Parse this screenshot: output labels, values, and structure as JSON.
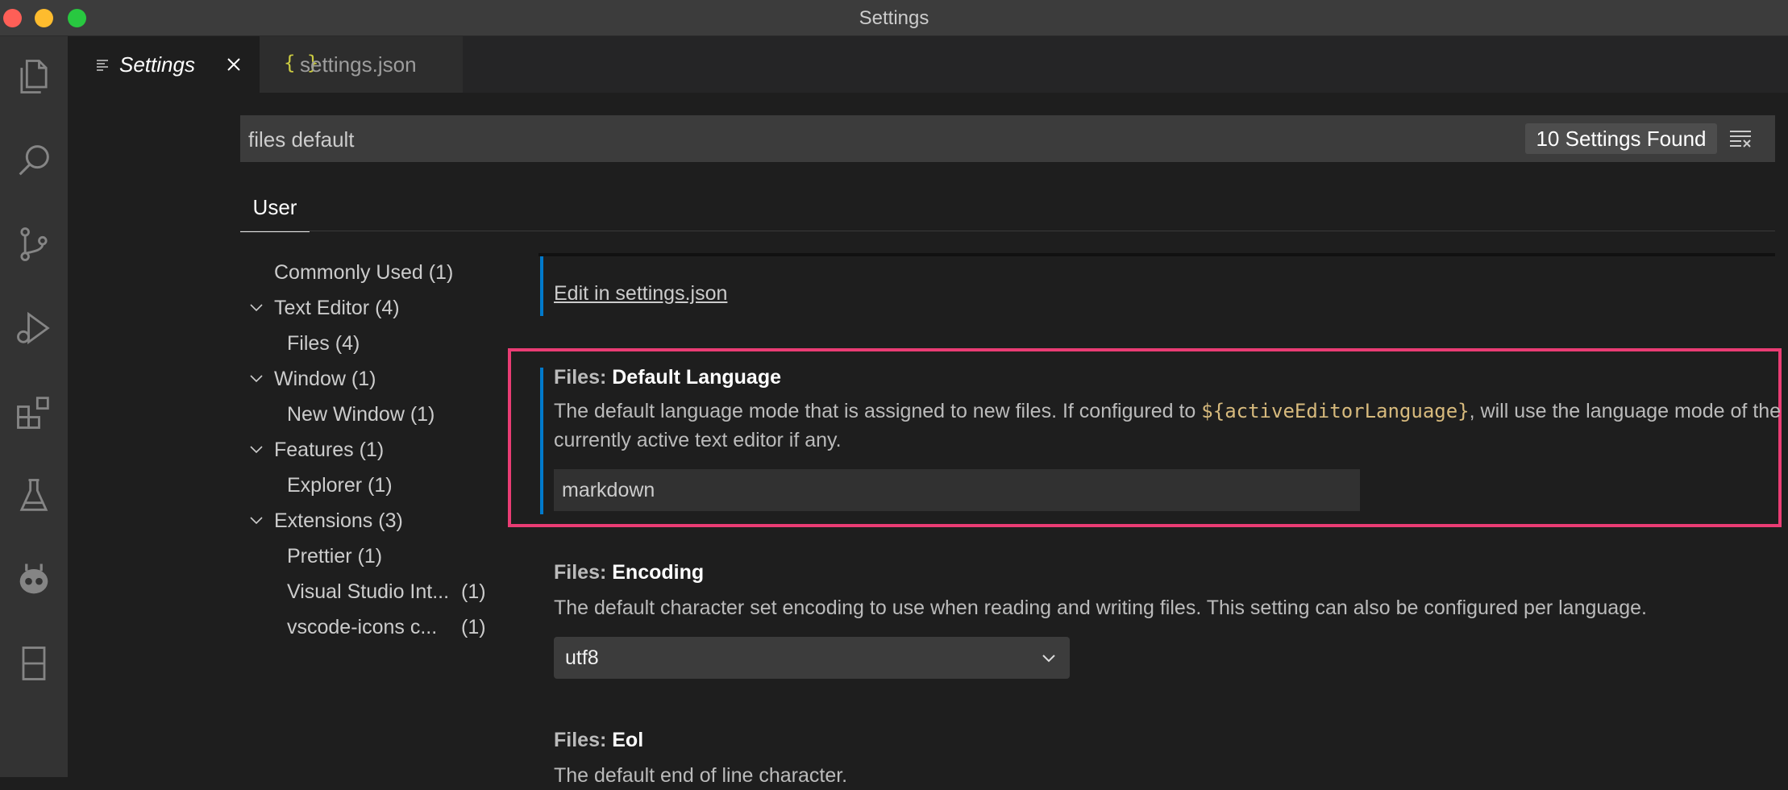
{
  "window": {
    "title": "Settings"
  },
  "activity_bar": {
    "icons": [
      "files-icon",
      "search-icon",
      "source-control-icon",
      "run-debug-icon",
      "extensions-icon",
      "testing-icon",
      "alien-icon",
      "layout-icon"
    ]
  },
  "tabs": [
    {
      "label": "Settings",
      "icon": "settings-lines-icon",
      "active": true
    },
    {
      "label": "settings.json",
      "icon": "json-braces-icon",
      "active": false
    }
  ],
  "search": {
    "value": "files default",
    "result_count": "10 Settings Found"
  },
  "scope_tabs": [
    {
      "label": "User"
    }
  ],
  "toc": [
    {
      "label": "Commonly Used",
      "count": "(1)",
      "level": 0,
      "expanded": null
    },
    {
      "label": "Text Editor",
      "count": "(4)",
      "level": 0,
      "expanded": true
    },
    {
      "label": "Files",
      "count": "(4)",
      "level": 1
    },
    {
      "label": "Window",
      "count": "(1)",
      "level": 0,
      "expanded": true
    },
    {
      "label": "New Window",
      "count": "(1)",
      "level": 1
    },
    {
      "label": "Features",
      "count": "(1)",
      "level": 0,
      "expanded": true
    },
    {
      "label": "Explorer",
      "count": "(1)",
      "level": 1
    },
    {
      "label": "Extensions",
      "count": "(3)",
      "level": 0,
      "expanded": true
    },
    {
      "label": "Prettier",
      "count": "(1)",
      "level": 1
    },
    {
      "label": "Visual Studio Int...",
      "count": "(1)",
      "level": 1
    },
    {
      "label": "vscode-icons c...",
      "count": "(1)",
      "level": 1
    }
  ],
  "settings": {
    "edit_link": "Edit in settings.json",
    "default_language": {
      "category": "Files:",
      "name": "Default Language",
      "desc_before": "The default language mode that is assigned to new files. If configured to ",
      "desc_code": "${activeEditorLanguage}",
      "desc_after": ", will use the language mode of the currently active text editor if any.",
      "value": "markdown"
    },
    "encoding": {
      "category": "Files:",
      "name": "Encoding",
      "desc": "The default character set encoding to use when reading and writing files. This setting can also be configured per language.",
      "value": "utf8"
    },
    "eol": {
      "category": "Files:",
      "name": "Eol",
      "desc": "The default end of line character."
    }
  },
  "colors": {
    "accent": "#007acc",
    "highlight": "#ea3c74",
    "code": "#d7ba7d"
  }
}
